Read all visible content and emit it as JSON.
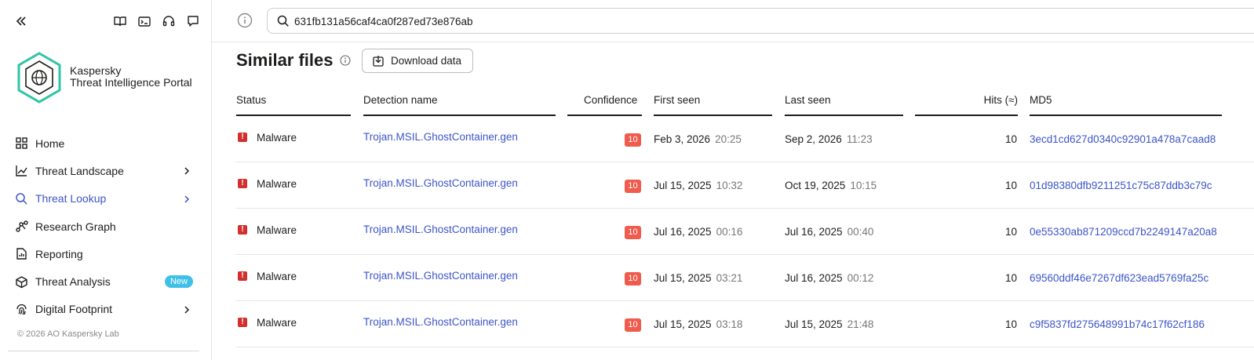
{
  "sidebar": {
    "brand": {
      "line1": "Kaspersky",
      "line2": "Threat Intelligence Portal"
    },
    "items": [
      {
        "label": "Home",
        "icon": "home-icon"
      },
      {
        "label": "Threat Landscape",
        "icon": "chart-line-icon",
        "chevron": true
      },
      {
        "label": "Threat Lookup",
        "icon": "search-icon",
        "chevron": true,
        "active": true
      },
      {
        "label": "Research Graph",
        "icon": "graph-icon"
      },
      {
        "label": "Reporting",
        "icon": "report-icon"
      },
      {
        "label": "Threat Analysis",
        "icon": "cube-icon",
        "badge": "New"
      },
      {
        "label": "Digital Footprint",
        "icon": "fingerprint-icon",
        "chevron": true
      }
    ],
    "copyright": "© 2026 AO Kaspersky Lab"
  },
  "search": {
    "value": "631fb131a56caf4ca0f287ed73e876ab"
  },
  "main": {
    "heading": "Similar files",
    "download_label": "Download data",
    "columns": {
      "status": "Status",
      "detection": "Detection name",
      "confidence": "Confidence",
      "first_seen": "First seen",
      "last_seen": "Last seen",
      "hits": "Hits (≈)",
      "md5": "MD5"
    },
    "rows": [
      {
        "status": "Malware",
        "detection": "Trojan.MSIL.GhostContainer.gen",
        "confidence": "10",
        "first_date": "Feb 3, 2026",
        "first_time": "20:25",
        "last_date": "Sep 2, 2026",
        "last_time": "11:23",
        "hits": "10",
        "md5": "3ecd1cd627d0340c92901a478a7caad8"
      },
      {
        "status": "Malware",
        "detection": "Trojan.MSIL.GhostContainer.gen",
        "confidence": "10",
        "first_date": "Jul 15, 2025",
        "first_time": "10:32",
        "last_date": "Oct 19, 2025",
        "last_time": "10:15",
        "hits": "10",
        "md5": "01d98380dfb9211251c75c87ddb3c79c"
      },
      {
        "status": "Malware",
        "detection": "Trojan.MSIL.GhostContainer.gen",
        "confidence": "10",
        "first_date": "Jul 16, 2025",
        "first_time": "00:16",
        "last_date": "Jul 16, 2025",
        "last_time": "00:40",
        "hits": "10",
        "md5": "0e55330ab871209ccd7b2249147a20a8"
      },
      {
        "status": "Malware",
        "detection": "Trojan.MSIL.GhostContainer.gen",
        "confidence": "10",
        "first_date": "Jul 15, 2025",
        "first_time": "03:21",
        "last_date": "Jul 16, 2025",
        "last_time": "00:12",
        "hits": "10",
        "md5": "69560ddf46e7267df623ead5769fa25c"
      },
      {
        "status": "Malware",
        "detection": "Trojan.MSIL.GhostContainer.gen",
        "confidence": "10",
        "first_date": "Jul 15, 2025",
        "first_time": "03:18",
        "last_date": "Jul 15, 2025",
        "last_time": "21:48",
        "hits": "10",
        "md5": "c9f5837fd275648991b74c17f62cf186"
      }
    ]
  },
  "colors": {
    "accent": "#3d55c9",
    "danger": "#d32f2f",
    "confidence": "#ef5b4c",
    "badge": "#40c0e7",
    "logo": "#2ec4a6"
  }
}
